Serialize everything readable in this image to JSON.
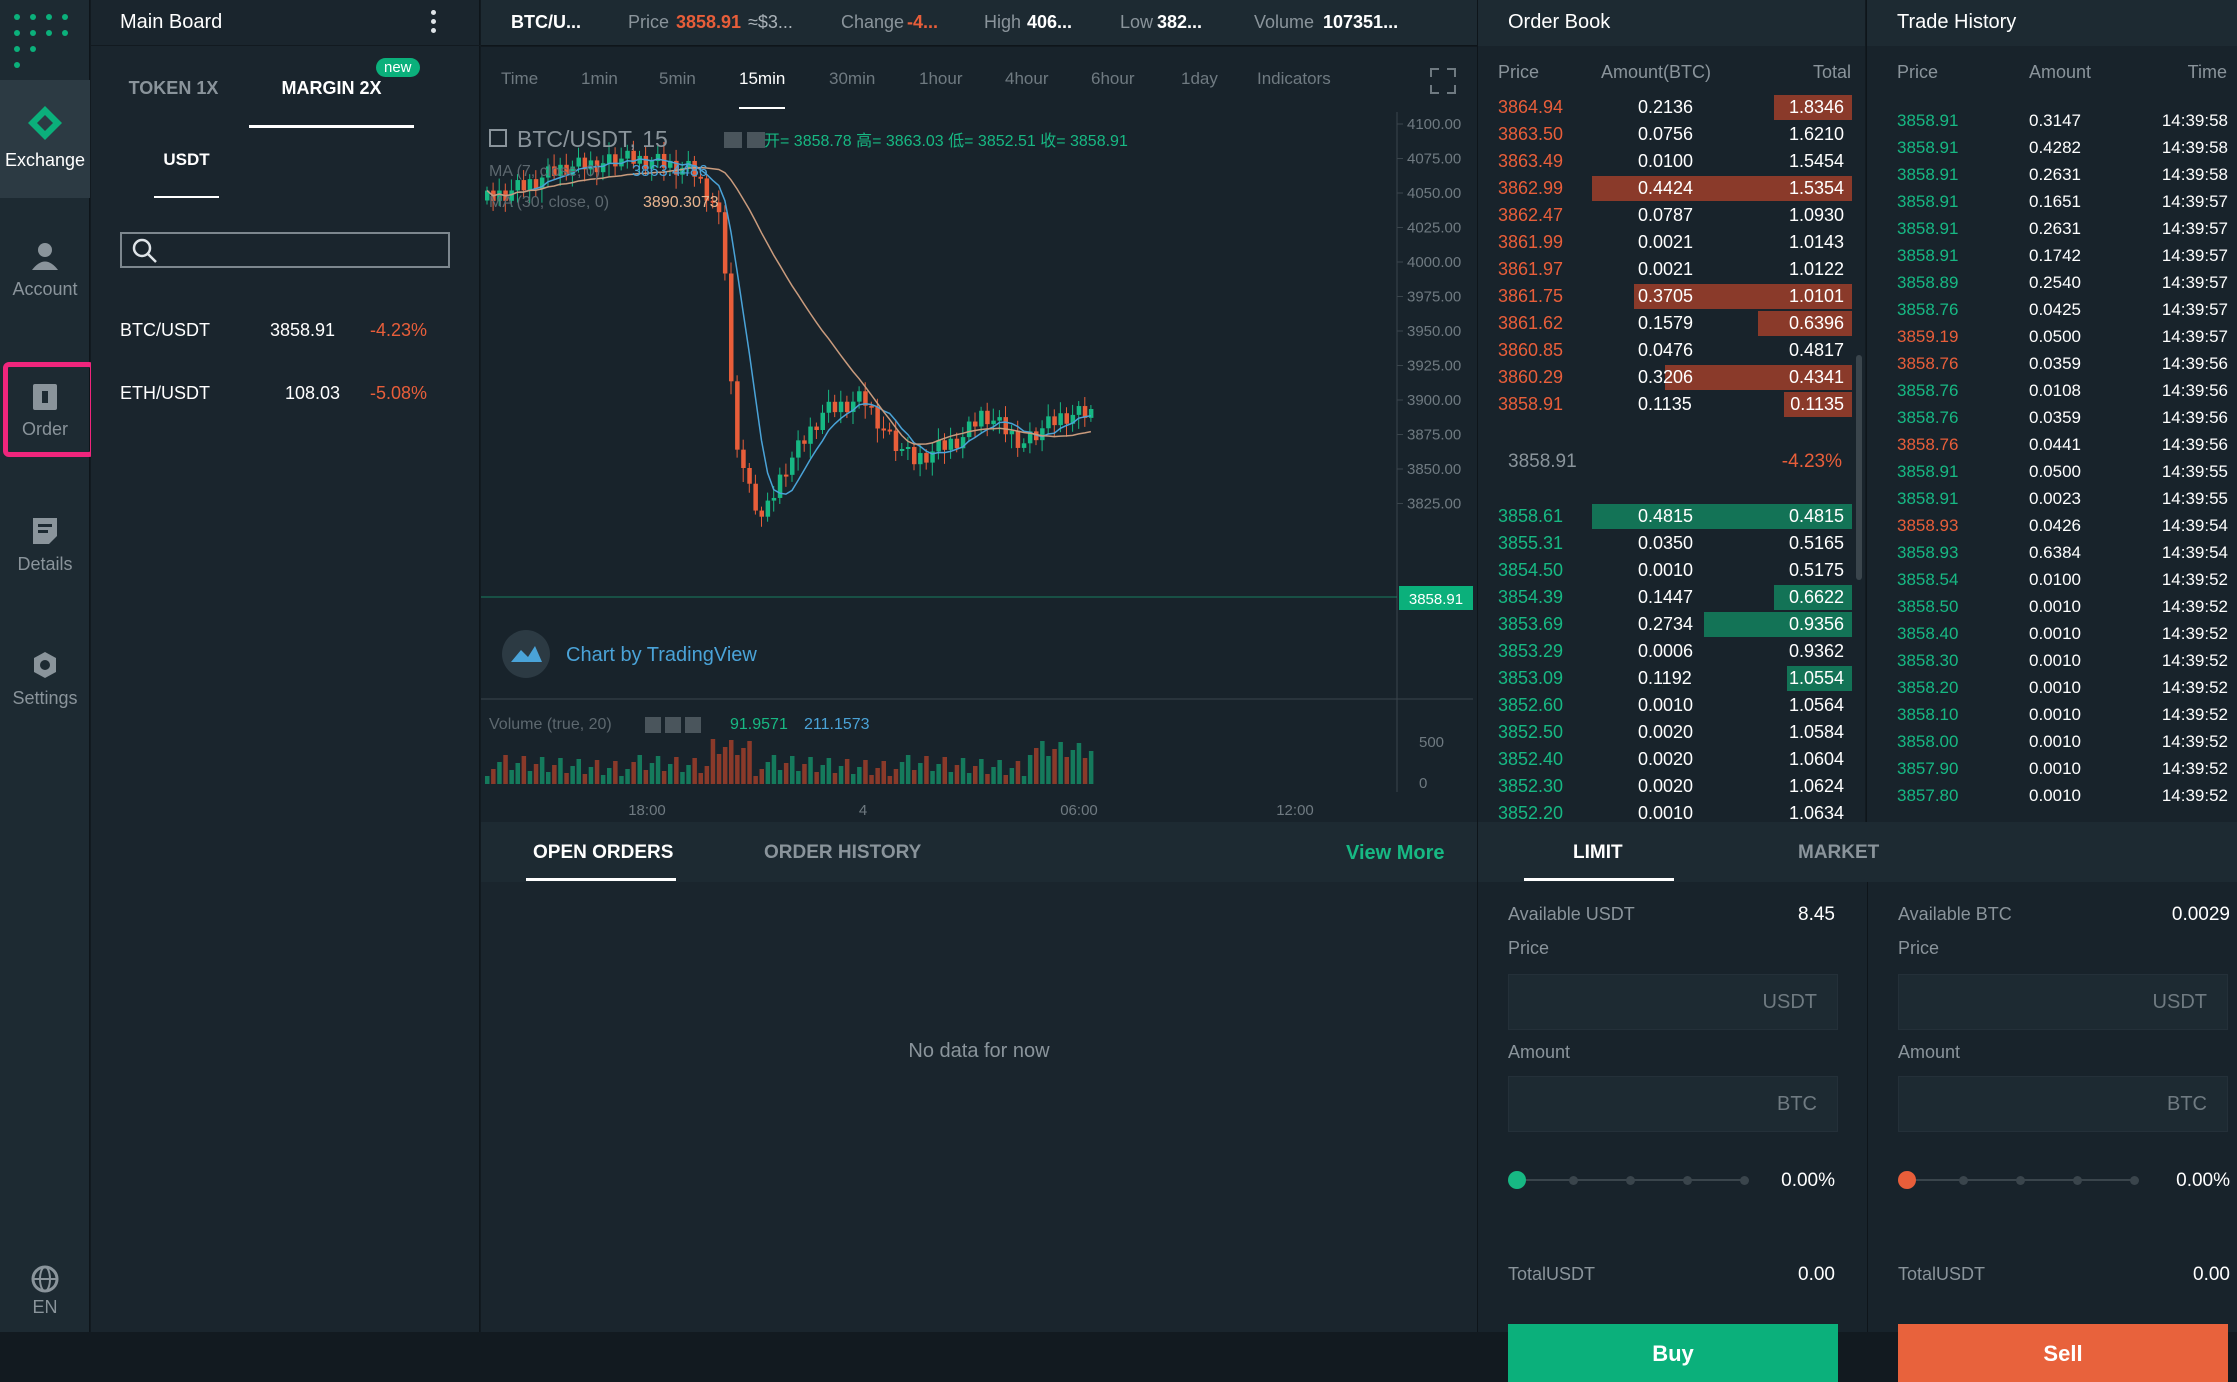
{
  "sidebar": {
    "items": [
      {
        "label": "Exchange"
      },
      {
        "label": "Account"
      },
      {
        "label": "Order"
      },
      {
        "label": "Details"
      },
      {
        "label": "Settings"
      }
    ],
    "lang": "EN"
  },
  "market_panel": {
    "title": "Main Board",
    "tabs": [
      {
        "label": "TOKEN 1X"
      },
      {
        "label": "MARGIN 2X"
      }
    ],
    "new_badge": "new",
    "quote_tab": "USDT",
    "pairs": [
      {
        "pair": "BTC/USDT",
        "price": "3858.91",
        "change": "-4.23%"
      },
      {
        "pair": "ETH/USDT",
        "price": "108.03",
        "change": "-5.08%"
      }
    ]
  },
  "ticker": {
    "pair": "BTC/U...",
    "price_label": "Price",
    "price": "3858.91",
    "price_approx": "≈$3...",
    "change_label": "Change",
    "change": "-4...",
    "high_label": "High",
    "high": "406...",
    "low_label": "Low",
    "low": "382...",
    "volume_label": "Volume",
    "volume": "107351..."
  },
  "timeframes": [
    "Time",
    "1min",
    "5min",
    "15min",
    "30min",
    "1hour",
    "4hour",
    "6hour",
    "1day",
    "Indicators"
  ],
  "chart": {
    "symbol": "BTC/USDT, 15",
    "ohlc": "开= 3858.78  高= 3863.03  低= 3852.51  收= 3858.91",
    "ma7_label": "MA (7, close, 0)",
    "ma7_value": "3863.4486",
    "ma30_label": "MA (30, close, 0)",
    "ma30_value": "3890.3073",
    "branding": "Chart by TradingView",
    "volume_label": "Volume (true, 20)",
    "vol_values": [
      "91.9571",
      "211.1573"
    ],
    "price_axis": [
      "4100.00",
      "4075.00",
      "4050.00",
      "4025.00",
      "4000.00",
      "3975.00",
      "3950.00",
      "3925.00",
      "3900.00",
      "3875.00",
      "3850.00",
      "3825.00"
    ],
    "current_price": "3858.91",
    "vol_axis": [
      "500",
      "0"
    ],
    "time_axis": [
      "18:00",
      "4",
      "06:00",
      "12:00"
    ]
  },
  "orderbook": {
    "title": "Order Book",
    "cols": [
      "Price",
      "Amount(BTC)",
      "Total"
    ],
    "asks": [
      {
        "p": "3864.94",
        "a": "0.2136",
        "t": "1.8346",
        "d": 0.3
      },
      {
        "p": "3863.50",
        "a": "0.0756",
        "t": "1.6210",
        "d": 0.0
      },
      {
        "p": "3863.49",
        "a": "0.0100",
        "t": "1.5454",
        "d": 0.0
      },
      {
        "p": "3862.99",
        "a": "0.4424",
        "t": "1.5354",
        "d": 1.0
      },
      {
        "p": "3862.47",
        "a": "0.0787",
        "t": "1.0930",
        "d": 0.0
      },
      {
        "p": "3861.99",
        "a": "0.0021",
        "t": "1.0143",
        "d": 0.0
      },
      {
        "p": "3861.97",
        "a": "0.0021",
        "t": "1.0122",
        "d": 0.0
      },
      {
        "p": "3861.75",
        "a": "0.3705",
        "t": "1.0101",
        "d": 0.84
      },
      {
        "p": "3861.62",
        "a": "0.1579",
        "t": "0.6396",
        "d": 0.36
      },
      {
        "p": "3860.85",
        "a": "0.0476",
        "t": "0.4817",
        "d": 0.0
      },
      {
        "p": "3860.29",
        "a": "0.3206",
        "t": "0.4341",
        "d": 0.72
      },
      {
        "p": "3858.91",
        "a": "0.1135",
        "t": "0.1135",
        "d": 0.26
      }
    ],
    "mid_price": "3858.91",
    "mid_change": "-4.23%",
    "bids": [
      {
        "p": "3858.61",
        "a": "0.4815",
        "t": "0.4815",
        "d": 1.0
      },
      {
        "p": "3855.31",
        "a": "0.0350",
        "t": "0.5165",
        "d": 0.0
      },
      {
        "p": "3854.50",
        "a": "0.0010",
        "t": "0.5175",
        "d": 0.0
      },
      {
        "p": "3854.39",
        "a": "0.1447",
        "t": "0.6622",
        "d": 0.3
      },
      {
        "p": "3853.69",
        "a": "0.2734",
        "t": "0.9356",
        "d": 0.57
      },
      {
        "p": "3853.29",
        "a": "0.0006",
        "t": "0.9362",
        "d": 0.0
      },
      {
        "p": "3853.09",
        "a": "0.1192",
        "t": "1.0554",
        "d": 0.25
      },
      {
        "p": "3852.60",
        "a": "0.0010",
        "t": "1.0564",
        "d": 0.0
      },
      {
        "p": "3852.50",
        "a": "0.0020",
        "t": "1.0584",
        "d": 0.0
      },
      {
        "p": "3852.40",
        "a": "0.0020",
        "t": "1.0604",
        "d": 0.0
      },
      {
        "p": "3852.30",
        "a": "0.0020",
        "t": "1.0624",
        "d": 0.0
      },
      {
        "p": "3852.20",
        "a": "0.0010",
        "t": "1.0634",
        "d": 0.0
      }
    ]
  },
  "trade_history": {
    "title": "Trade History",
    "cols": [
      "Price",
      "Amount",
      "Time"
    ],
    "rows": [
      {
        "p": "3858.91",
        "a": "0.3147",
        "t": "14:39:58",
        "s": "g"
      },
      {
        "p": "3858.91",
        "a": "0.4282",
        "t": "14:39:58",
        "s": "g"
      },
      {
        "p": "3858.91",
        "a": "0.2631",
        "t": "14:39:58",
        "s": "g"
      },
      {
        "p": "3858.91",
        "a": "0.1651",
        "t": "14:39:57",
        "s": "g"
      },
      {
        "p": "3858.91",
        "a": "0.2631",
        "t": "14:39:57",
        "s": "g"
      },
      {
        "p": "3858.91",
        "a": "0.1742",
        "t": "14:39:57",
        "s": "g"
      },
      {
        "p": "3858.89",
        "a": "0.2540",
        "t": "14:39:57",
        "s": "g"
      },
      {
        "p": "3858.76",
        "a": "0.0425",
        "t": "14:39:57",
        "s": "g"
      },
      {
        "p": "3859.19",
        "a": "0.0500",
        "t": "14:39:57",
        "s": "r"
      },
      {
        "p": "3858.76",
        "a": "0.0359",
        "t": "14:39:56",
        "s": "r"
      },
      {
        "p": "3858.76",
        "a": "0.0108",
        "t": "14:39:56",
        "s": "g"
      },
      {
        "p": "3858.76",
        "a": "0.0359",
        "t": "14:39:56",
        "s": "g"
      },
      {
        "p": "3858.76",
        "a": "0.0441",
        "t": "14:39:56",
        "s": "r"
      },
      {
        "p": "3858.91",
        "a": "0.0500",
        "t": "14:39:55",
        "s": "g"
      },
      {
        "p": "3858.91",
        "a": "0.0023",
        "t": "14:39:55",
        "s": "g"
      },
      {
        "p": "3858.93",
        "a": "0.0426",
        "t": "14:39:54",
        "s": "r"
      },
      {
        "p": "3858.93",
        "a": "0.6384",
        "t": "14:39:54",
        "s": "g"
      },
      {
        "p": "3858.54",
        "a": "0.0100",
        "t": "14:39:52",
        "s": "g"
      },
      {
        "p": "3858.50",
        "a": "0.0010",
        "t": "14:39:52",
        "s": "g"
      },
      {
        "p": "3858.40",
        "a": "0.0010",
        "t": "14:39:52",
        "s": "g"
      },
      {
        "p": "3858.30",
        "a": "0.0010",
        "t": "14:39:52",
        "s": "g"
      },
      {
        "p": "3858.20",
        "a": "0.0010",
        "t": "14:39:52",
        "s": "g"
      },
      {
        "p": "3858.10",
        "a": "0.0010",
        "t": "14:39:52",
        "s": "g"
      },
      {
        "p": "3858.00",
        "a": "0.0010",
        "t": "14:39:52",
        "s": "g"
      },
      {
        "p": "3857.90",
        "a": "0.0010",
        "t": "14:39:52",
        "s": "g"
      },
      {
        "p": "3857.80",
        "a": "0.0010",
        "t": "14:39:52",
        "s": "g"
      }
    ]
  },
  "orders": {
    "tabs": [
      "OPEN ORDERS",
      "ORDER HISTORY"
    ],
    "view_more": "View More",
    "empty": "No data for now"
  },
  "trade_form": {
    "tabs": [
      "LIMIT",
      "MARKET"
    ],
    "buy": {
      "available_label": "Available USDT",
      "available": "8.45",
      "price_label": "Price",
      "price_unit": "USDT",
      "amount_label": "Amount",
      "amount_unit": "BTC",
      "percent": "0.00%",
      "total_label": "TotalUSDT",
      "total": "0.00",
      "button": "Buy"
    },
    "sell": {
      "available_label": "Available BTC",
      "available": "0.0029",
      "price_label": "Price",
      "price_unit": "USDT",
      "amount_label": "Amount",
      "amount_unit": "BTC",
      "percent": "0.00%",
      "total_label": "TotalUSDT",
      "total": "0.00",
      "button": "Sell"
    }
  },
  "colors": {
    "green": "#17b883",
    "red": "#e85e3a",
    "highlight": "#f0257c",
    "buy_button": "#0bb07b",
    "sell_button": "#e8623c"
  }
}
